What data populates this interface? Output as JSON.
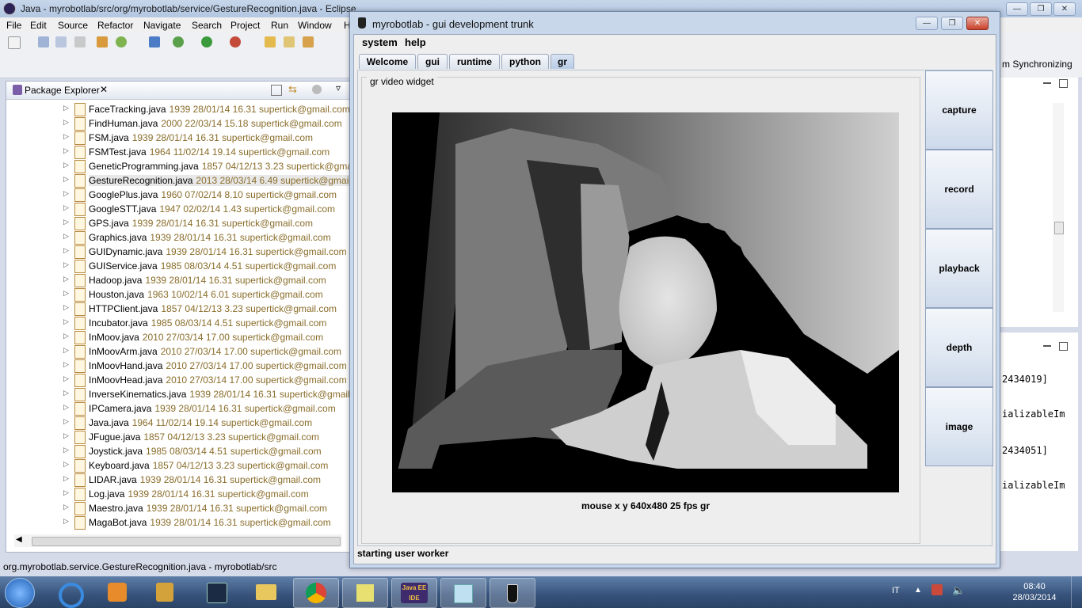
{
  "eclipse": {
    "window_title": "Java - myrobotlab/src/org/myrobotlab/service/GestureRecognition.java - Eclipse",
    "menu": [
      "File",
      "Edit",
      "Source",
      "Refactor",
      "Navigate",
      "Search",
      "Project",
      "Run",
      "Window",
      "H"
    ],
    "package_explorer": {
      "title": "Package Explorer",
      "files": [
        {
          "name": "FaceTracking.java",
          "meta": "1939  28/01/14 16.31  supertick@gmail.com"
        },
        {
          "name": "FindHuman.java",
          "meta": "2000  22/03/14 15.18  supertick@gmail.com"
        },
        {
          "name": "FSM.java",
          "meta": "1939  28/01/14 16.31  supertick@gmail.com"
        },
        {
          "name": "FSMTest.java",
          "meta": "1964  11/02/14 19.14  supertick@gmail.com"
        },
        {
          "name": "GeneticProgramming.java",
          "meta": "1857  04/12/13 3.23  supertick@gma"
        },
        {
          "name": "GestureRecognition.java",
          "meta": "2013  28/03/14 6.49  supertick@gmail."
        },
        {
          "name": "GooglePlus.java",
          "meta": "1960  07/02/14 8.10  supertick@gmail.com"
        },
        {
          "name": "GoogleSTT.java",
          "meta": "1947  02/02/14 1.43  supertick@gmail.com"
        },
        {
          "name": "GPS.java",
          "meta": "1939  28/01/14 16.31  supertick@gmail.com"
        },
        {
          "name": "Graphics.java",
          "meta": "1939  28/01/14 16.31  supertick@gmail.com"
        },
        {
          "name": "GUIDynamic.java",
          "meta": "1939  28/01/14 16.31  supertick@gmail.com"
        },
        {
          "name": "GUIService.java",
          "meta": "1985  08/03/14 4.51  supertick@gmail.com"
        },
        {
          "name": "Hadoop.java",
          "meta": "1939  28/01/14 16.31  supertick@gmail.com"
        },
        {
          "name": "Houston.java",
          "meta": "1963  10/02/14 6.01  supertick@gmail.com"
        },
        {
          "name": "HTTPClient.java",
          "meta": "1857  04/12/13 3.23  supertick@gmail.com"
        },
        {
          "name": "Incubator.java",
          "meta": "1985  08/03/14 4.51  supertick@gmail.com"
        },
        {
          "name": "InMoov.java",
          "meta": "2010  27/03/14 17.00  supertick@gmail.com"
        },
        {
          "name": "InMoovArm.java",
          "meta": "2010  27/03/14 17.00  supertick@gmail.com"
        },
        {
          "name": "InMoovHand.java",
          "meta": "2010  27/03/14 17.00  supertick@gmail.com"
        },
        {
          "name": "InMoovHead.java",
          "meta": "2010  27/03/14 17.00  supertick@gmail.com"
        },
        {
          "name": "InverseKinematics.java",
          "meta": "1939  28/01/14 16.31  supertick@gmail.c"
        },
        {
          "name": "IPCamera.java",
          "meta": "1939  28/01/14 16.31  supertick@gmail.com"
        },
        {
          "name": "Java.java",
          "meta": "1964  11/02/14 19.14  supertick@gmail.com"
        },
        {
          "name": "JFugue.java",
          "meta": "1857  04/12/13 3.23  supertick@gmail.com"
        },
        {
          "name": "Joystick.java",
          "meta": "1985  08/03/14 4.51  supertick@gmail.com"
        },
        {
          "name": "Keyboard.java",
          "meta": "1857  04/12/13 3.23  supertick@gmail.com"
        },
        {
          "name": "LIDAR.java",
          "meta": "1939  28/01/14 16.31  supertick@gmail.com"
        },
        {
          "name": "Log.java",
          "meta": "1939  28/01/14 16.31  supertick@gmail.com"
        },
        {
          "name": "Maestro.java",
          "meta": "1939  28/01/14 16.31  supertick@gmail.com"
        },
        {
          "name": "MagaBot.java",
          "meta": "1939  28/01/14 16.31  supertick@gmail.com"
        }
      ]
    },
    "right_panel": {
      "header_text": "m Synchronizing",
      "code_lines": [
        "2434019]",
        "ializableIm",
        "2434051]",
        "ializableIm"
      ]
    },
    "status_text": "org.myrobotlab.service.GestureRecognition.java - myrobotlab/src"
  },
  "mrl": {
    "title": "myrobotlab - gui development trunk",
    "menu": {
      "system": "system",
      "help": "help"
    },
    "tabs": [
      "Welcome",
      "gui",
      "runtime",
      "python",
      "gr"
    ],
    "widget_title": "gr  video widget",
    "video_status": "mouse x y  640x480  25 fps  gr",
    "buttons": {
      "capture": "capture",
      "record": "record",
      "playback": "playback",
      "depth": "depth",
      "image": "image"
    },
    "status": "starting user worker"
  },
  "taskbar": {
    "language": "IT",
    "time": "08:40",
    "date": "28/03/2014",
    "apps": [
      "internet-explorer",
      "media-player",
      "tool",
      "terminal",
      "file-explorer",
      "chrome",
      "sticky-notes",
      "java-ee-ide",
      "notepad",
      "myrobotlab"
    ],
    "java_ide_label": "Java EE IDE"
  },
  "colors": {
    "accent": "#b3c7e2",
    "taskbar": "#36527a",
    "file_meta": "#8a6d2a"
  }
}
